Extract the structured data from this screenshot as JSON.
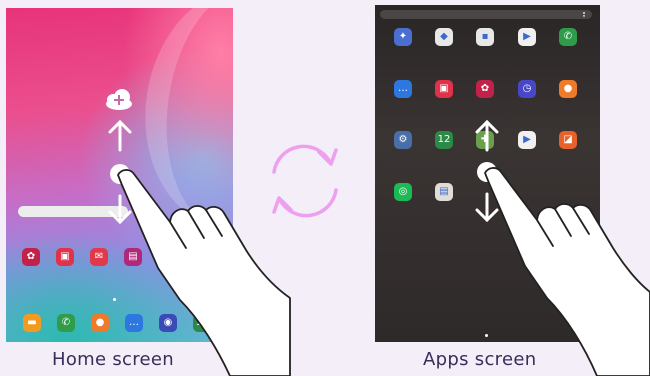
{
  "captions": {
    "home": "Home screen",
    "apps": "Apps screen"
  },
  "colors": {
    "rotate_icon": "#ef9ff0",
    "caption_text": "#3a2d5a"
  },
  "icons": {
    "cloud": "cloud-upload-icon",
    "arrow_up": "arrow-up-icon",
    "arrow_down": "arrow-down-icon",
    "hand": "hand-pointer-icon",
    "rotate": "rotate-arrows-icon"
  },
  "home_favorites_row": [
    {
      "glyph": "✿",
      "color": "#c2224a"
    },
    {
      "glyph": "▣",
      "color": "#e0324a"
    },
    {
      "glyph": "✉",
      "color": "#e03a4a"
    },
    {
      "glyph": "▤",
      "color": "#b0287a"
    }
  ],
  "home_dock": [
    {
      "glyph": "▬",
      "color": "#f29b1f"
    },
    {
      "glyph": "✆",
      "color": "#2e9c4a"
    },
    {
      "glyph": "●",
      "color": "#ee7a2a"
    },
    {
      "glyph": "…",
      "color": "#2d78e0"
    },
    {
      "glyph": "◉",
      "color": "#3a4bb8"
    },
    {
      "glyph": "12",
      "color": "#2c8a48"
    }
  ],
  "apps_grid": [
    {
      "glyph": "✦",
      "color": "#4a6fd0"
    },
    {
      "glyph": "◆",
      "color": "#e8e8e8"
    },
    {
      "glyph": "▪",
      "color": "#e8e8e8"
    },
    {
      "glyph": "▶",
      "color": "#f0f0f0"
    },
    {
      "glyph": "✆",
      "color": "#2e9c4a"
    },
    {
      "glyph": "…",
      "color": "#2d78e0"
    },
    {
      "glyph": "▣",
      "color": "#e0324a"
    },
    {
      "glyph": "✿",
      "color": "#c2224a"
    },
    {
      "glyph": "◷",
      "color": "#4a46c8"
    },
    {
      "glyph": "●",
      "color": "#ee7a2a"
    },
    {
      "glyph": "⚙",
      "color": "#4a6fa8"
    },
    {
      "glyph": "12",
      "color": "#2c8a48"
    },
    {
      "glyph": "✚",
      "color": "#6aa04a"
    },
    {
      "glyph": "▶",
      "color": "#f0f0f0"
    },
    {
      "glyph": "◪",
      "color": "#e8602a"
    },
    {
      "glyph": "◎",
      "color": "#1db954"
    },
    {
      "glyph": "▤",
      "color": "#e0ddd8"
    }
  ]
}
